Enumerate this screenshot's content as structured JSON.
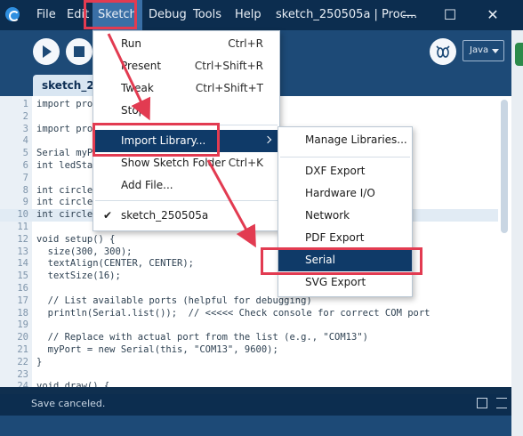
{
  "titlebar": {
    "menus": [
      "File",
      "Edit",
      "Sketch",
      "Debug",
      "Tools",
      "Help"
    ],
    "window_title": "sketch_250505a | Proc...",
    "minimize_glyph": "—",
    "maximize_glyph": "☐",
    "close_glyph": "✕"
  },
  "toolbar": {
    "mode": "Java",
    "icons": [
      "run-icon",
      "stop-icon",
      "debugger-icon",
      "dropdown-arrow-icon"
    ]
  },
  "tab": {
    "label": "sketch_250505a"
  },
  "editor": {
    "current_line": 10,
    "lines": [
      {
        "n": "1",
        "text": "import processing.serial.*;"
      },
      {
        "n": "2",
        "text": ""
      },
      {
        "n": "3",
        "text": "import processing.sound.*;"
      },
      {
        "n": "4",
        "text": ""
      },
      {
        "n": "5",
        "text": "Serial myPort;"
      },
      {
        "n": "6",
        "text": "int ledState = 0;"
      },
      {
        "n": "7",
        "text": ""
      },
      {
        "n": "8",
        "text": "int circleX;"
      },
      {
        "n": "9",
        "text": "int circleY;"
      },
      {
        "n": "10",
        "text": "int circleD;"
      },
      {
        "n": "11",
        "text": ""
      },
      {
        "n": "12",
        "text": "void setup() {"
      },
      {
        "n": "13",
        "text": "  size(300, 300);"
      },
      {
        "n": "14",
        "text": "  textAlign(CENTER, CENTER);"
      },
      {
        "n": "15",
        "text": "  textSize(16);"
      },
      {
        "n": "16",
        "text": ""
      },
      {
        "n": "17",
        "text": "  // List available ports (helpful for debugging)"
      },
      {
        "n": "18",
        "text": "  println(Serial.list());  // <<<<< Check console for correct COM port"
      },
      {
        "n": "19",
        "text": ""
      },
      {
        "n": "20",
        "text": "  // Replace with actual port from the list (e.g., \"COM13\")"
      },
      {
        "n": "21",
        "text": "  myPort = new Serial(this, \"COM13\", 9600);"
      },
      {
        "n": "22",
        "text": "}"
      },
      {
        "n": "23",
        "text": ""
      },
      {
        "n": "24",
        "text": "void draw() {"
      }
    ]
  },
  "status": {
    "message": "Save canceled."
  },
  "sketch_menu": {
    "items": [
      {
        "label": "Run",
        "accel": "Ctrl+R"
      },
      {
        "label": "Present",
        "accel": "Ctrl+Shift+R"
      },
      {
        "label": "Tweak",
        "accel": "Ctrl+Shift+T"
      },
      {
        "label": "Stop",
        "accel": ""
      },
      {
        "label": "Import Library...",
        "accel": ""
      },
      {
        "label": "Show Sketch Folder",
        "accel": "Ctrl+K"
      },
      {
        "label": "Add File...",
        "accel": ""
      },
      {
        "label": "sketch_250505a",
        "accel": ""
      }
    ],
    "check_glyph": "✔"
  },
  "library_menu": {
    "items": [
      "Manage Libraries...",
      "DXF Export",
      "Hardware I/O",
      "Network",
      "PDF Export",
      "Serial",
      "SVG Export"
    ]
  },
  "colors": {
    "title_bg": "#0c2d4f",
    "toolbar_bg": "#1d4a77",
    "menu_highlight": "#0f3a68",
    "annotation_red": "#e23b51"
  }
}
